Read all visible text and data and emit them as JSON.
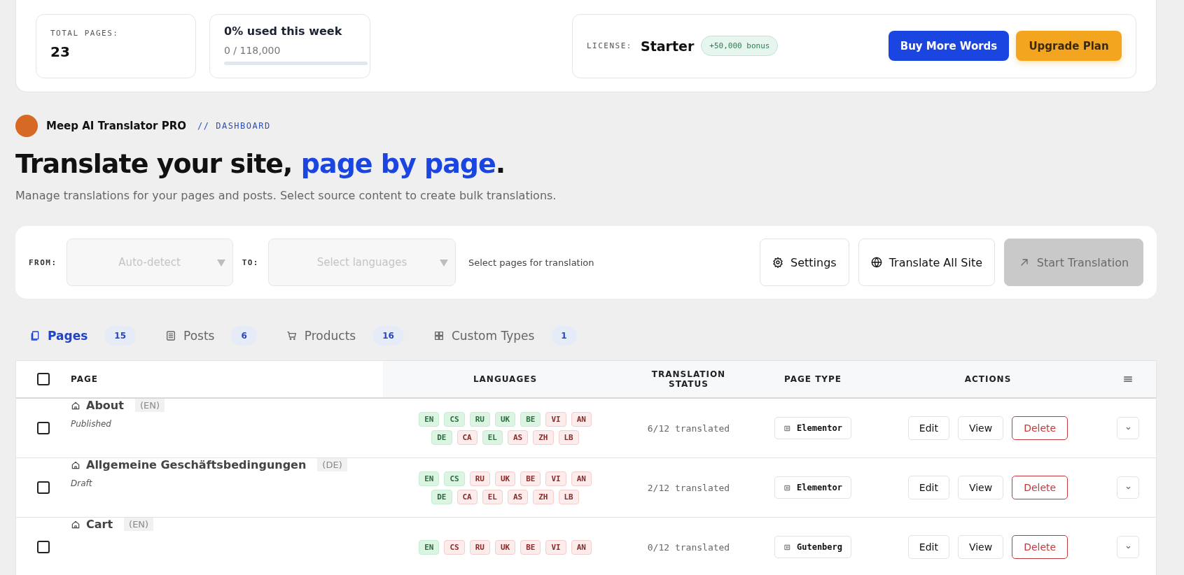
{
  "stats": {
    "total_pages": {
      "label": "TOTAL PAGES:",
      "value": "23"
    },
    "usage": {
      "title": "0% used this week",
      "reading": "0 / 118,000",
      "level": 0
    }
  },
  "license": {
    "label": "LICENSE:",
    "plan": "Starter",
    "bonus": "+50,000 bonus",
    "buttons": [
      {
        "label": "Buy More Words",
        "kind": "primary"
      },
      {
        "label": "Upgrade Plan",
        "kind": "warning"
      }
    ]
  },
  "brand": {
    "name": "Meep AI Translator PRO",
    "breadcrumb": "// DASHBOARD"
  },
  "heading": "Translate your site, **page by page**.",
  "subtitle": "Manage translations for your pages and posts. Select source content to create bulk translations.",
  "filter": {
    "from_label": "FROM:",
    "from_placeholder": "Auto-detect",
    "to_label": "TO:",
    "to_placeholder": "Select languages",
    "hint": "Select pages for translation",
    "buttons": [
      {
        "label": "Settings",
        "kind": "settings",
        "disabled": false
      },
      {
        "label": "Translate All Site",
        "kind": "globe",
        "disabled": false
      },
      {
        "label": "Start Translation",
        "kind": "start",
        "disabled": true
      }
    ]
  },
  "tabs": [
    {
      "label": "Pages",
      "count": "15",
      "kind": "pages",
      "selected": true
    },
    {
      "label": "Posts",
      "count": "6",
      "kind": "posts",
      "selected": false
    },
    {
      "label": "Products",
      "count": "16",
      "kind": "products",
      "selected": false
    },
    {
      "label": "Custom Types",
      "count": "1",
      "kind": "custom",
      "selected": false
    }
  ],
  "table": {
    "columns": [
      "PAGE",
      "LANGUAGES",
      "TRANSLATION STATUS",
      "PAGE TYPE",
      "ACTIONS"
    ],
    "all_checked": false,
    "rows": [
      {
        "title": "About",
        "lang": "(EN)",
        "status": "Published",
        "checked": false,
        "languages": [
          {
            "code": "EN",
            "translated": true
          },
          {
            "code": "CS",
            "translated": true
          },
          {
            "code": "RU",
            "translated": true
          },
          {
            "code": "UK",
            "translated": true
          },
          {
            "code": "BE",
            "translated": true
          },
          {
            "code": "VI",
            "translated": false
          },
          {
            "code": "AN",
            "translated": false
          },
          {
            "code": "DE",
            "translated": true
          },
          {
            "code": "CA",
            "translated": false
          },
          {
            "code": "EL",
            "translated": true
          },
          {
            "code": "AS",
            "translated": false
          },
          {
            "code": "ZH",
            "translated": false
          },
          {
            "code": "LB",
            "translated": false
          }
        ],
        "progress": "6/12 translated",
        "type": "Elementor",
        "actions": [
          "Edit",
          "View",
          "Delete"
        ]
      },
      {
        "title": "Allgemeine Geschäftsbedingungen",
        "lang": "(DE)",
        "status": "Draft",
        "checked": false,
        "languages": [
          {
            "code": "EN",
            "translated": true
          },
          {
            "code": "CS",
            "translated": true
          },
          {
            "code": "RU",
            "translated": false
          },
          {
            "code": "UK",
            "translated": false
          },
          {
            "code": "BE",
            "translated": false
          },
          {
            "code": "VI",
            "translated": false
          },
          {
            "code": "AN",
            "translated": false
          },
          {
            "code": "DE",
            "translated": true
          },
          {
            "code": "CA",
            "translated": false
          },
          {
            "code": "EL",
            "translated": false
          },
          {
            "code": "AS",
            "translated": false
          },
          {
            "code": "ZH",
            "translated": false
          },
          {
            "code": "LB",
            "translated": false
          }
        ],
        "progress": "2/12 translated",
        "type": "Elementor",
        "actions": [
          "Edit",
          "View",
          "Delete"
        ]
      },
      {
        "title": "Cart",
        "lang": "(EN)",
        "checked": false,
        "languages": [
          {
            "code": "EN",
            "translated": true
          },
          {
            "code": "CS",
            "translated": false
          },
          {
            "code": "RU",
            "translated": false
          },
          {
            "code": "UK",
            "translated": false
          },
          {
            "code": "BE",
            "translated": false
          },
          {
            "code": "VI",
            "translated": false
          },
          {
            "code": "AN",
            "translated": false
          }
        ],
        "progress": "0/12 translated",
        "type": "Gutenberg",
        "actions": [
          "Edit",
          "View",
          "Delete"
        ]
      }
    ]
  }
}
